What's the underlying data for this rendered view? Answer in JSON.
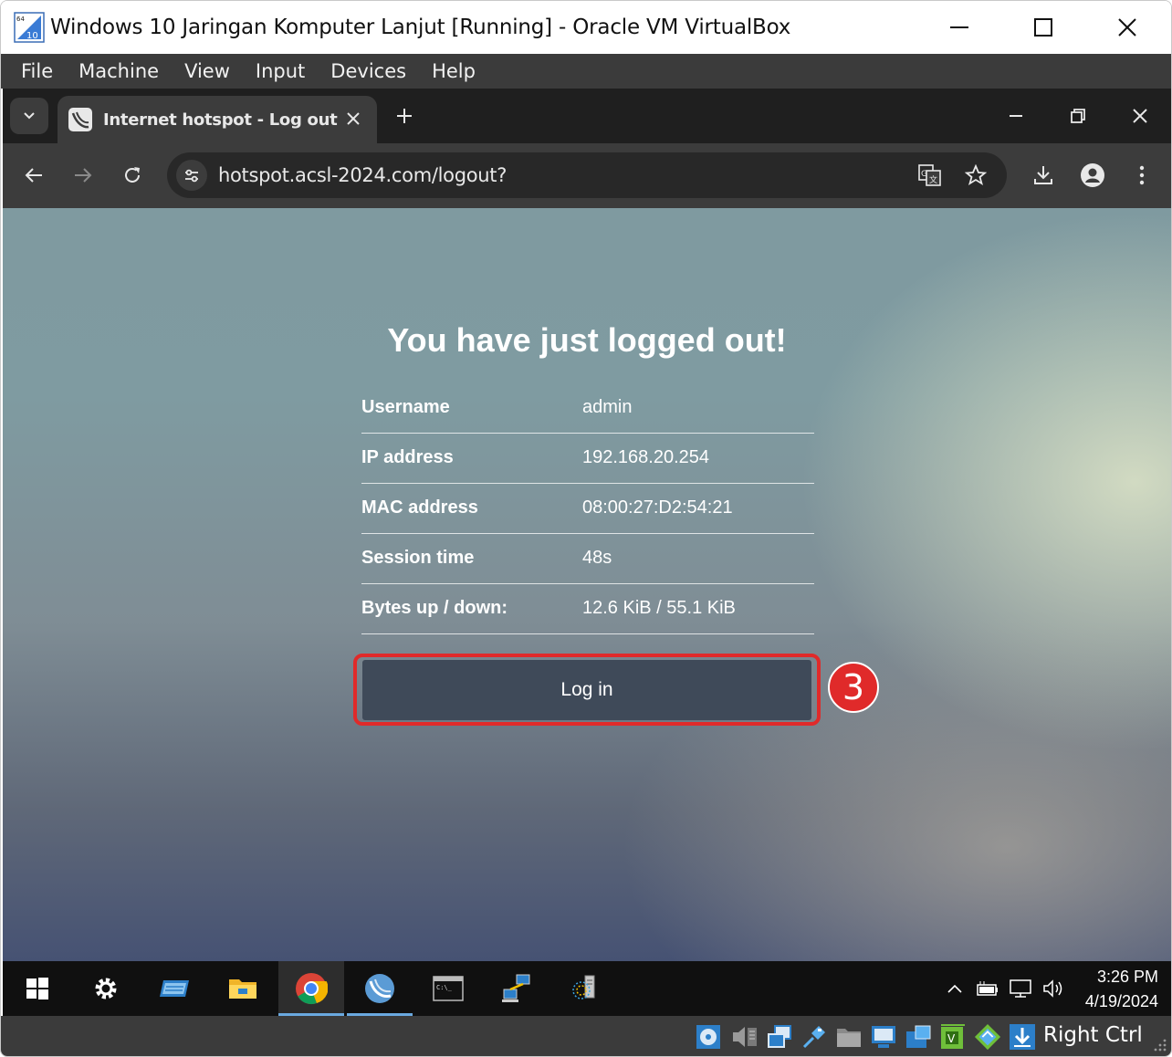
{
  "vbox": {
    "title": "Windows 10 Jaringan Komputer Lanjut [Running] - Oracle VM VirtualBox",
    "menu": [
      "File",
      "Machine",
      "View",
      "Input",
      "Devices",
      "Help"
    ],
    "host_key": "Right Ctrl",
    "status_icons": [
      "optical-drive-icon",
      "audio-icon",
      "network-icon",
      "usb-icon",
      "shared-folders-icon",
      "display-icon",
      "recording-icon",
      "cpu-icon",
      "mouse-integration-icon",
      "download-icon"
    ]
  },
  "browser": {
    "tab_title": "Internet hotspot - Log out",
    "url": "hotspot.acsl-2024.com/logout?",
    "favicon": "mikrotik-icon"
  },
  "page": {
    "heading": "You have just logged out!",
    "rows": [
      {
        "label": "Username",
        "value": "admin"
      },
      {
        "label": "IP address",
        "value": "192.168.20.254"
      },
      {
        "label": "MAC address",
        "value": "08:00:27:D2:54:21"
      },
      {
        "label": "Session time",
        "value": "48s"
      },
      {
        "label": "Bytes up / down:",
        "value": "12.6 KiB / 55.1 KiB"
      }
    ],
    "login_label": "Log in",
    "step_number": "3",
    "highlight_color": "#e02a2a",
    "button_color": "#3f4a59"
  },
  "taskbar": {
    "apps": [
      "windows-start-icon",
      "settings-icon",
      "server-manager-icon",
      "file-explorer-icon",
      "chrome-icon",
      "winbox-icon",
      "terminal-icon",
      "network-connections-icon",
      "dns-icon"
    ],
    "time": "3:26 PM",
    "date": "4/19/2024"
  }
}
